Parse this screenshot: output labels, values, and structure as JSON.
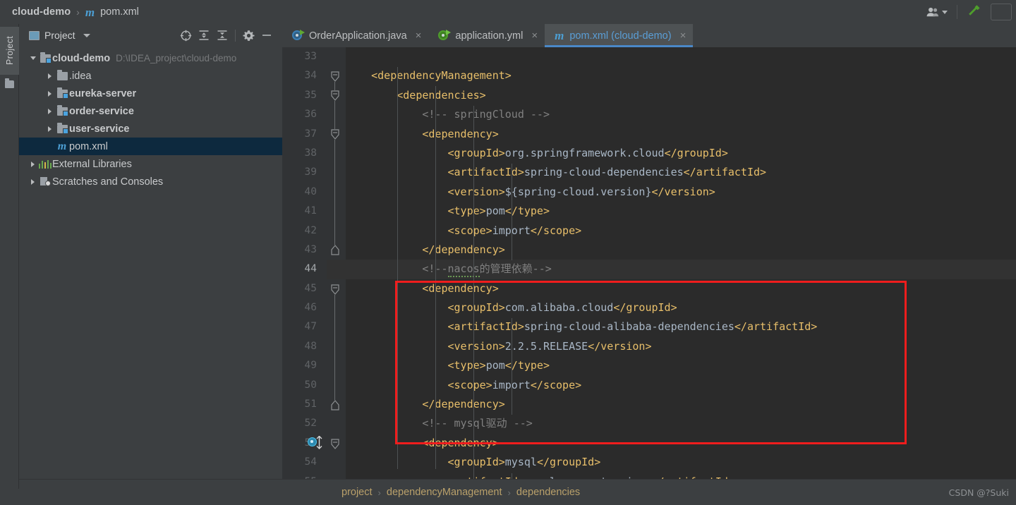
{
  "window": {
    "breadcrumb": {
      "project": "cloud-demo",
      "separator": "›",
      "file": "pom.xml",
      "maven_glyph": "m"
    },
    "toolbar_right": {
      "people_icon": "people-icon",
      "dropdown_icon": "chevron-down-icon",
      "build_icon": "hammer-icon"
    }
  },
  "left_strip": {
    "label": "Project",
    "folder_icon": "folder-icon"
  },
  "project_panel": {
    "title": "Project",
    "tab_icon": "project-window-icon",
    "dropdown_icon": "chevron-down-icon",
    "tools": [
      {
        "name": "locate-icon",
        "glyph": "⊕"
      },
      {
        "name": "expand-all-icon",
        "glyph": "≡"
      },
      {
        "name": "collapse-all-icon",
        "glyph": "≡"
      },
      {
        "name": "settings-gear-icon",
        "glyph": "⚙"
      },
      {
        "name": "hide-window-icon",
        "glyph": "—"
      }
    ],
    "tree": [
      {
        "label": "cloud-demo",
        "path": "D:\\IDEA_project\\cloud-demo",
        "indent": 0,
        "arrow": "down",
        "icon": "module-folder-icon",
        "bold": true,
        "selected": false
      },
      {
        "label": ".idea",
        "path": "",
        "indent": 1,
        "arrow": "right",
        "icon": "folder-icon",
        "bold": false,
        "selected": false
      },
      {
        "label": "eureka-server",
        "path": "",
        "indent": 1,
        "arrow": "right",
        "icon": "module-folder-icon",
        "bold": true,
        "selected": false
      },
      {
        "label": "order-service",
        "path": "",
        "indent": 1,
        "arrow": "right",
        "icon": "module-folder-icon",
        "bold": true,
        "selected": false
      },
      {
        "label": "user-service",
        "path": "",
        "indent": 1,
        "arrow": "right",
        "icon": "module-folder-icon",
        "bold": true,
        "selected": false
      },
      {
        "label": "pom.xml",
        "path": "",
        "indent": 2,
        "arrow": "none",
        "icon": "maven-file-icon",
        "bold": false,
        "selected": true
      },
      {
        "label": "External Libraries",
        "path": "",
        "indent": 0,
        "arrow": "right",
        "icon": "libraries-icon",
        "bold": false,
        "selected": false
      },
      {
        "label": "Scratches and Consoles",
        "path": "",
        "indent": 0,
        "arrow": "right",
        "icon": "scratches-icon",
        "bold": false,
        "selected": false
      }
    ]
  },
  "editor": {
    "tabs": [
      {
        "label": "OrderApplication.java",
        "icon": "spring-boot-blue-icon",
        "active": false,
        "close": "×"
      },
      {
        "label": "application.yml",
        "icon": "spring-boot-green-icon",
        "active": false,
        "close": "×"
      },
      {
        "label": "pom.xml (cloud-demo)",
        "icon": "maven-file-icon",
        "active": true,
        "close": "×"
      }
    ],
    "first_line_number": 33,
    "current_line": 44,
    "lines": [
      {
        "n": 33,
        "indent": 0,
        "segments": []
      },
      {
        "n": 34,
        "indent": 0,
        "segments": [
          {
            "t": "plain",
            "s": "    "
          },
          {
            "t": "tag",
            "s": "<dependencyManagement>"
          }
        ]
      },
      {
        "n": 35,
        "indent": 0,
        "segments": [
          {
            "t": "plain",
            "s": "        "
          },
          {
            "t": "tag",
            "s": "<dependencies>"
          }
        ]
      },
      {
        "n": 36,
        "indent": 0,
        "segments": [
          {
            "t": "plain",
            "s": "            "
          },
          {
            "t": "cmt",
            "s": "<!-- springCloud -->"
          }
        ]
      },
      {
        "n": 37,
        "indent": 0,
        "segments": [
          {
            "t": "plain",
            "s": "            "
          },
          {
            "t": "tag",
            "s": "<dependency>"
          }
        ]
      },
      {
        "n": 38,
        "indent": 0,
        "segments": [
          {
            "t": "plain",
            "s": "                "
          },
          {
            "t": "tag",
            "s": "<groupId>"
          },
          {
            "t": "val",
            "s": "org.springframework.cloud"
          },
          {
            "t": "tag",
            "s": "</groupId>"
          }
        ]
      },
      {
        "n": 39,
        "indent": 0,
        "segments": [
          {
            "t": "plain",
            "s": "                "
          },
          {
            "t": "tag",
            "s": "<artifactId>"
          },
          {
            "t": "val",
            "s": "spring-cloud-dependencies"
          },
          {
            "t": "tag",
            "s": "</artifactId>"
          }
        ]
      },
      {
        "n": 40,
        "indent": 0,
        "segments": [
          {
            "t": "plain",
            "s": "                "
          },
          {
            "t": "tag",
            "s": "<version>"
          },
          {
            "t": "val",
            "s": "${spring-cloud.version}"
          },
          {
            "t": "tag",
            "s": "</version>"
          }
        ]
      },
      {
        "n": 41,
        "indent": 0,
        "segments": [
          {
            "t": "plain",
            "s": "                "
          },
          {
            "t": "tag",
            "s": "<type>"
          },
          {
            "t": "val",
            "s": "pom"
          },
          {
            "t": "tag",
            "s": "</type>"
          }
        ]
      },
      {
        "n": 42,
        "indent": 0,
        "segments": [
          {
            "t": "plain",
            "s": "                "
          },
          {
            "t": "tag",
            "s": "<scope>"
          },
          {
            "t": "val",
            "s": "import"
          },
          {
            "t": "tag",
            "s": "</scope>"
          }
        ]
      },
      {
        "n": 43,
        "indent": 0,
        "segments": [
          {
            "t": "plain",
            "s": "            "
          },
          {
            "t": "tag",
            "s": "</dependency>"
          }
        ]
      },
      {
        "n": 44,
        "indent": 0,
        "segments": [
          {
            "t": "plain",
            "s": "            "
          },
          {
            "t": "cmt",
            "s": "<!--"
          },
          {
            "t": "cmt-spell",
            "s": "nacos"
          },
          {
            "t": "cmt",
            "s": "的管理依赖-->"
          }
        ]
      },
      {
        "n": 45,
        "indent": 0,
        "segments": [
          {
            "t": "plain",
            "s": "            "
          },
          {
            "t": "tag",
            "s": "<dependency>"
          }
        ]
      },
      {
        "n": 46,
        "indent": 0,
        "segments": [
          {
            "t": "plain",
            "s": "                "
          },
          {
            "t": "tag",
            "s": "<groupId>"
          },
          {
            "t": "val",
            "s": "com.alibaba.cloud"
          },
          {
            "t": "tag",
            "s": "</groupId>"
          }
        ]
      },
      {
        "n": 47,
        "indent": 0,
        "segments": [
          {
            "t": "plain",
            "s": "                "
          },
          {
            "t": "tag",
            "s": "<artifactId>"
          },
          {
            "t": "val",
            "s": "spring-cloud-alibaba-dependencies"
          },
          {
            "t": "tag",
            "s": "</artifactId>"
          }
        ]
      },
      {
        "n": 48,
        "indent": 0,
        "segments": [
          {
            "t": "plain",
            "s": "                "
          },
          {
            "t": "tag",
            "s": "<version>"
          },
          {
            "t": "val",
            "s": "2.2.5.RELEASE"
          },
          {
            "t": "tag",
            "s": "</version>"
          }
        ]
      },
      {
        "n": 49,
        "indent": 0,
        "segments": [
          {
            "t": "plain",
            "s": "                "
          },
          {
            "t": "tag",
            "s": "<type>"
          },
          {
            "t": "val",
            "s": "pom"
          },
          {
            "t": "tag",
            "s": "</type>"
          }
        ]
      },
      {
        "n": 50,
        "indent": 0,
        "segments": [
          {
            "t": "plain",
            "s": "                "
          },
          {
            "t": "tag",
            "s": "<scope>"
          },
          {
            "t": "val",
            "s": "import"
          },
          {
            "t": "tag",
            "s": "</scope>"
          }
        ]
      },
      {
        "n": 51,
        "indent": 0,
        "segments": [
          {
            "t": "plain",
            "s": "            "
          },
          {
            "t": "tag",
            "s": "</dependency>"
          }
        ]
      },
      {
        "n": 52,
        "indent": 0,
        "segments": [
          {
            "t": "plain",
            "s": "            "
          },
          {
            "t": "cmt",
            "s": "<!-- mysql驱动 -->"
          }
        ]
      },
      {
        "n": 53,
        "indent": 0,
        "segments": [
          {
            "t": "plain",
            "s": "            "
          },
          {
            "t": "tag",
            "s": "<dependency>"
          }
        ]
      },
      {
        "n": 54,
        "indent": 0,
        "segments": [
          {
            "t": "plain",
            "s": "                "
          },
          {
            "t": "tag",
            "s": "<groupId>"
          },
          {
            "t": "val",
            "s": "mysql"
          },
          {
            "t": "tag",
            "s": "</groupId>"
          }
        ]
      },
      {
        "n": 55,
        "indent": 0,
        "segments": [
          {
            "t": "plain",
            "s": "                "
          },
          {
            "t": "tag",
            "s": "<artifactId>"
          },
          {
            "t": "val",
            "s": "mysql-connector-java"
          },
          {
            "t": "tag",
            "s": "</artifactId>"
          }
        ]
      }
    ],
    "gutter_marker": {
      "line": 53,
      "name": "maven-dependency-icon"
    },
    "annotation": {
      "name": "red-highlight-rectangle",
      "color": "#f01d1d",
      "covers_lines": "44-51"
    }
  },
  "status_breadcrumb": {
    "items": [
      "project",
      "dependencyManagement",
      "dependencies"
    ],
    "separator": "›"
  },
  "watermark": {
    "text": "CSDN @?Suki"
  },
  "colors": {
    "panel_bg": "#3c3f41",
    "editor_bg": "#2b2b2b",
    "gutter_bg": "#313335",
    "tag": "#e8bf6a",
    "value": "#a9b7c6",
    "comment": "#808080",
    "selection": "#0d293e",
    "accent_blue": "#4a88c7",
    "annotation_red": "#f01d1d"
  }
}
